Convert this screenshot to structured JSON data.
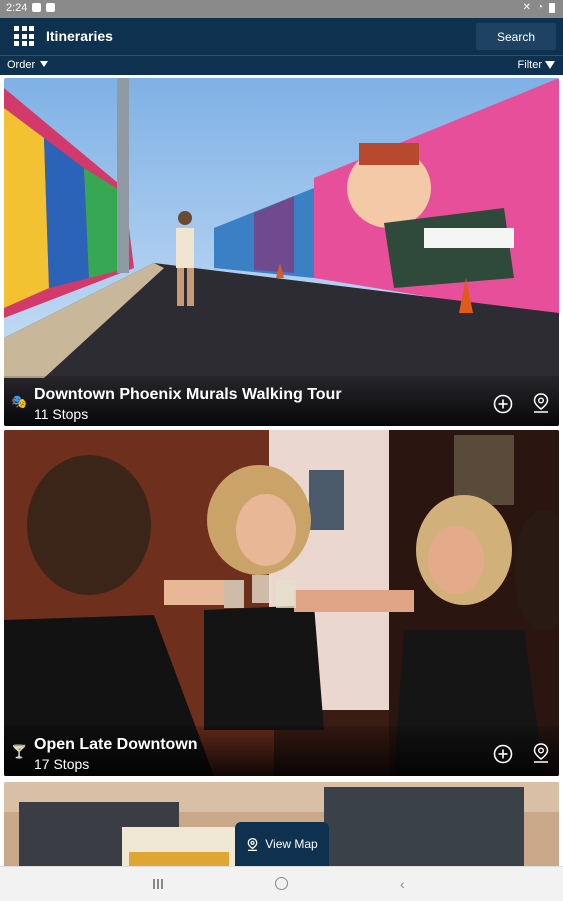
{
  "status_bar": {
    "time": "2:24"
  },
  "app_bar": {
    "title": "Itineraries",
    "search_label": "Search"
  },
  "sub_bar": {
    "order_label": "Order",
    "filter_label": "Filter"
  },
  "itineraries": [
    {
      "title": "Downtown Phoenix Murals Walking Tour",
      "stops": "11 Stops",
      "category_icon": "theater-masks-icon"
    },
    {
      "title": "Open Late Downtown",
      "stops": "17 Stops",
      "category_icon": "cocktail-icon"
    }
  ],
  "view_map_label": "View Map",
  "colors": {
    "primary": "#0e3150",
    "primary_light": "#1d4262"
  }
}
